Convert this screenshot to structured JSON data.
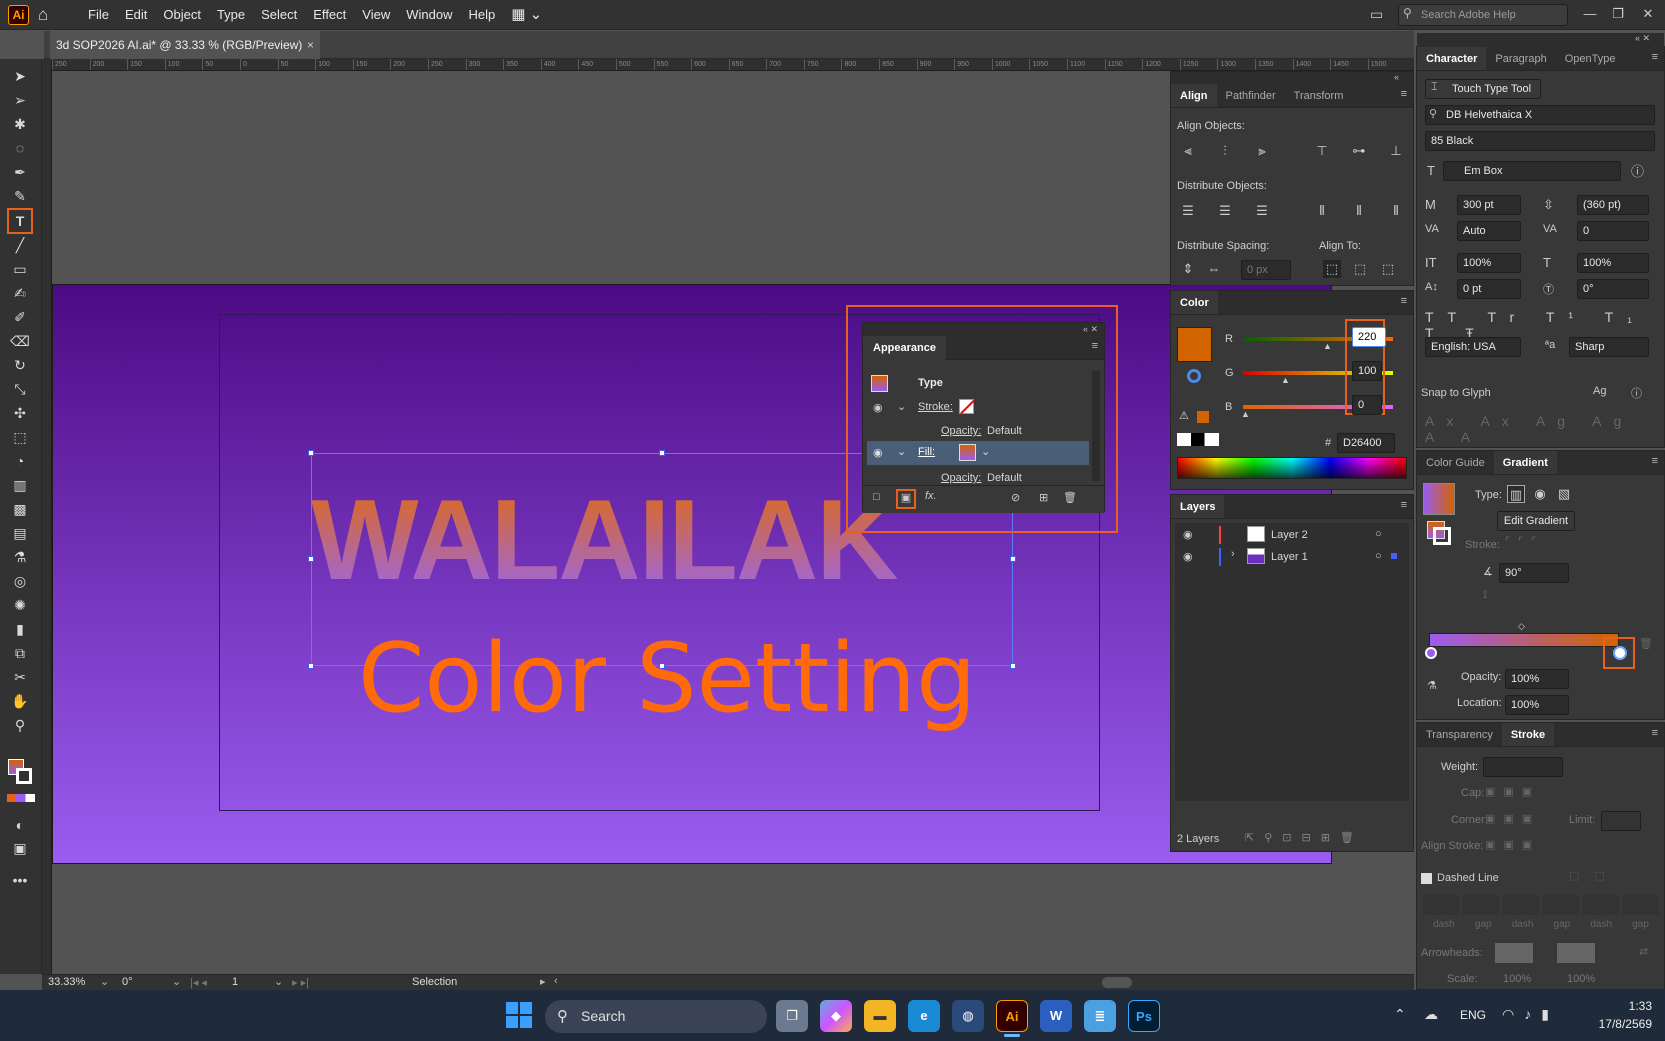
{
  "app": {
    "logo": "Ai"
  },
  "menu": [
    "File",
    "Edit",
    "Object",
    "Type",
    "Select",
    "Effect",
    "View",
    "Window",
    "Help"
  ],
  "help_search": {
    "placeholder": "Search Adobe Help"
  },
  "document": {
    "tab": "3d SOP2026 AI.ai* @ 33.33 % (RGB/Preview)",
    "close": "×"
  },
  "ruler_ticks": [
    "250",
    "200",
    "150",
    "100",
    "50",
    "0",
    "50",
    "100",
    "150",
    "200",
    "250",
    "300",
    "350",
    "400",
    "450",
    "500",
    "550",
    "600",
    "650",
    "700",
    "750",
    "800",
    "850",
    "900",
    "950",
    "1000",
    "1050",
    "1100",
    "1150",
    "1200",
    "1250",
    "1300",
    "1350",
    "1400",
    "1450",
    "1500"
  ],
  "artwork": {
    "headline": "WALAILAK",
    "subtitle": "Color Setting"
  },
  "appearance": {
    "title": "Appearance",
    "type_label": "Type",
    "stroke_label": "Stroke:",
    "opacity_label": "Opacity:",
    "opacity_value": "Default",
    "fill_label": "Fill:",
    "opacity2_label": "Opacity:",
    "opacity2_value": "Default",
    "fx": "fx."
  },
  "align": {
    "tabs": [
      "Align",
      "Pathfinder",
      "Transform"
    ],
    "align_objects": "Align Objects:",
    "distribute_objects": "Distribute Objects:",
    "distribute_spacing": "Distribute Spacing:",
    "align_to": "Align To:",
    "spacing_value": "0 px"
  },
  "color": {
    "title": "Color",
    "r_label": "R",
    "g_label": "G",
    "b_label": "B",
    "r": "220",
    "g": "100",
    "b": "0",
    "hex_label": "#",
    "hex": "D26400",
    "swatch": "#d26400"
  },
  "layers": {
    "title": "Layers",
    "items": [
      {
        "name": "Layer 2",
        "color": "#ff4040"
      },
      {
        "name": "Layer 1",
        "color": "#4060ff"
      }
    ],
    "count": "2 Layers"
  },
  "character": {
    "tabs": [
      "Character",
      "Paragraph",
      "OpenType"
    ],
    "touch_type": "Touch Type Tool",
    "font": "DB Helvethaica X",
    "style": "85 Black",
    "box": "Em Box",
    "size": "300 pt",
    "leading": "(360 pt)",
    "kerning": "Auto",
    "tracking": "0",
    "vscale": "100%",
    "hscale": "100%",
    "baseline": "0 pt",
    "rotation": "0°",
    "language": "English: USA",
    "aa": "Sharp",
    "snap": "Snap to Glyph"
  },
  "gradient": {
    "tabs": [
      "Color Guide",
      "Gradient"
    ],
    "type_label": "Type:",
    "edit": "Edit Gradient",
    "stroke_label": "Stroke:",
    "angle": "90°",
    "opacity_label": "Opacity:",
    "opacity": "100%",
    "location_label": "Location:",
    "location": "100%",
    "start_color": "#9b5cf0",
    "end_color": "#d26400"
  },
  "stroke": {
    "tabs": [
      "Transparency",
      "Stroke"
    ],
    "weight_label": "Weight:",
    "cap_label": "Cap:",
    "corner_label": "Corner:",
    "limit_label": "Limit:",
    "align_label": "Align Stroke:",
    "dashed": "Dashed Line",
    "dash_labels": [
      "dash",
      "gap",
      "dash",
      "gap",
      "dash",
      "gap"
    ],
    "arrowheads": "Arrowheads:",
    "scale": "Scale:",
    "scale1": "100%",
    "scale2": "100%"
  },
  "status": {
    "zoom": "33.33%",
    "rotate": "0°",
    "artboard": "1",
    "tool": "Selection"
  },
  "taskbar": {
    "search": "Search",
    "lang": "ENG",
    "time": "1:33",
    "date": "17/8/2569",
    "apps": [
      "Ai",
      "W",
      "Ps"
    ]
  }
}
